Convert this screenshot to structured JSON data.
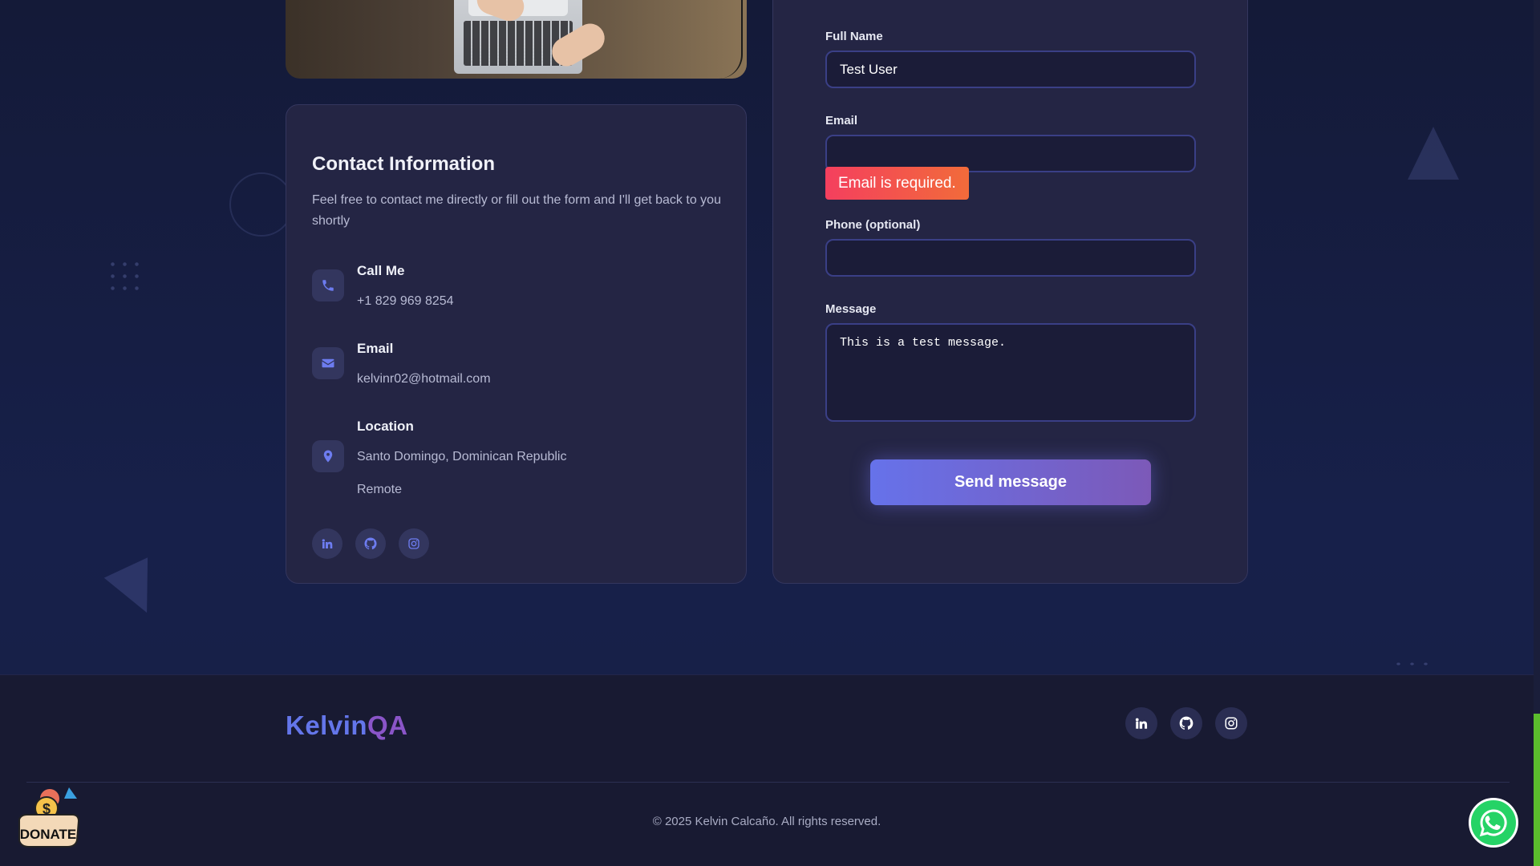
{
  "contact": {
    "title": "Contact Information",
    "description": "Feel free to contact me directly or fill out the form and I'll get back to you shortly",
    "call": {
      "label": "Call Me",
      "value": "+1 829 969 8254",
      "icon": "phone-icon"
    },
    "email": {
      "label": "Email",
      "value": "kelvinr02@hotmail.com",
      "icon": "envelope-icon"
    },
    "location": {
      "label": "Location",
      "value": "Santo Domingo, Dominican Republic",
      "extra": "Remote",
      "icon": "map-pin-icon"
    },
    "socials": [
      "linkedin-icon",
      "github-icon",
      "instagram-icon"
    ]
  },
  "form": {
    "full_name": {
      "label": "Full Name",
      "value": "Test User"
    },
    "email": {
      "label": "Email",
      "value": "",
      "error": "Email is required."
    },
    "phone": {
      "label": "Phone (optional)",
      "value": ""
    },
    "message": {
      "label": "Message",
      "value": "This is a test message."
    },
    "submit_label": "Send message"
  },
  "footer": {
    "logo_part1": "Kelvin",
    "logo_part2": "QA",
    "copyright": "© 2025 Kelvin Calcaño. All rights reserved.",
    "socials": [
      "linkedin-icon",
      "github-icon",
      "instagram-icon"
    ]
  },
  "floating": {
    "donate_label": "DONATE",
    "donate_symbol": "$",
    "whatsapp_icon": "whatsapp-icon"
  },
  "colors": {
    "accent_blue": "#6476ea",
    "accent_purple": "#8a55c8",
    "error_red": "#f43f5e",
    "whatsapp_green": "#25d366"
  }
}
